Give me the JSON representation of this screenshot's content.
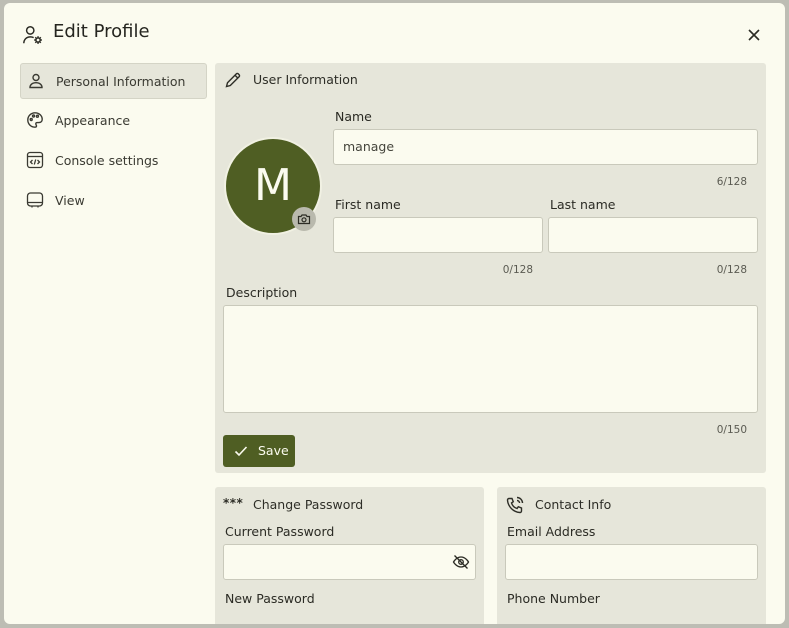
{
  "dialog": {
    "title": "Edit Profile",
    "close_icon": "close-icon"
  },
  "sidebar": {
    "items": [
      {
        "label": "Personal Information",
        "icon": "person-icon",
        "active": true
      },
      {
        "label": "Appearance",
        "icon": "palette-icon",
        "active": false
      },
      {
        "label": "Console settings",
        "icon": "code-window-icon",
        "active": false
      },
      {
        "label": "View",
        "icon": "monitor-icon",
        "active": false
      }
    ]
  },
  "user_info": {
    "title": "User Information",
    "avatar_letter": "M",
    "name_label": "Name",
    "name_value": "manage",
    "name_count": "6/128",
    "first_name_label": "First name",
    "first_name_value": "",
    "first_name_count": "0/128",
    "last_name_label": "Last name",
    "last_name_value": "",
    "last_name_count": "0/128",
    "description_label": "Description",
    "description_value": "",
    "description_count": "0/150",
    "save_label": "Save"
  },
  "change_password": {
    "title": "Change Password",
    "title_icon": "***",
    "current_label": "Current Password",
    "current_value": "",
    "new_label": "New Password"
  },
  "contact_info": {
    "title": "Contact Info",
    "email_label": "Email Address",
    "email_value": "",
    "phone_label": "Phone Number"
  },
  "colors": {
    "accent": "#4f5e23",
    "panel": "#e6e6da",
    "background": "#fbfbef"
  }
}
